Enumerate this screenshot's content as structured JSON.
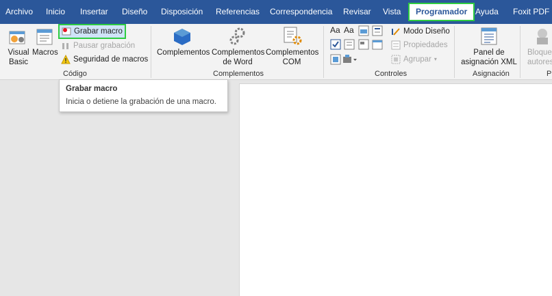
{
  "tabs": [
    {
      "label": "Archivo"
    },
    {
      "label": "Inicio"
    },
    {
      "label": "Insertar"
    },
    {
      "label": "Diseño"
    },
    {
      "label": "Disposición"
    },
    {
      "label": "Referencias"
    },
    {
      "label": "Correspondencia"
    },
    {
      "label": "Revisar"
    },
    {
      "label": "Vista"
    },
    {
      "label": "Programador",
      "active": true
    },
    {
      "label": "Ayuda"
    },
    {
      "label": "Foxit PDF"
    }
  ],
  "codigo": {
    "label": "Código",
    "visual_basic": "Visual Basic",
    "macros": "Macros",
    "grabar_macro": "Grabar macro",
    "pausar_grabacion": "Pausar grabación",
    "seguridad_macros": "Seguridad de macros"
  },
  "complementos": {
    "label": "Complementos",
    "complementos": "Complementos",
    "complementos_word": "Complementos de Word",
    "complementos_com": "Complementos COM"
  },
  "controles": {
    "label": "Controles",
    "modo_diseno": "Modo Diseño",
    "propiedades": "Propiedades",
    "agrupar": "Agrupar"
  },
  "asignacion": {
    "label": "Asignación",
    "panel_xml": "Panel de asignación XML"
  },
  "proteger": {
    "bloquear_autores": "Bloquear autores",
    "label_partial": "Pr"
  },
  "tooltip": {
    "title": "Grabar macro",
    "description": "Inicia o detiene la grabación de una macro."
  },
  "colors": {
    "ribbon_blue": "#2b579a",
    "highlight_green": "#2ecc40"
  }
}
